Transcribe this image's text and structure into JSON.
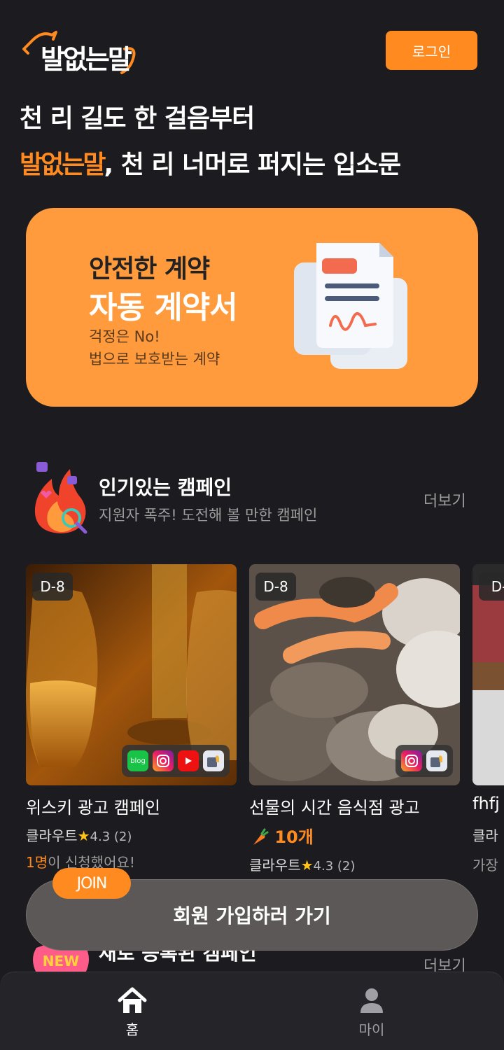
{
  "header": {
    "logo_text": "발없는말",
    "login_label": "로그인"
  },
  "hero": {
    "line1": "천 리 길도 한 걸음부터",
    "line2_brand": "발없는말",
    "line2_rest": ", 천 리 너머로 퍼지는 입소문"
  },
  "banner": {
    "title1": "안전한 계약",
    "title2": "자동 계약서",
    "sub1": "걱정은 No!",
    "sub2": "법으로 보호받는 계약"
  },
  "popular": {
    "title": "인기있는 캠페인",
    "subtitle": "지원자 폭주! 도전해 볼 만한 캠페인",
    "more": "더보기"
  },
  "cards": [
    {
      "dday": "D-8",
      "title": "위스키 광고 캠페인",
      "brand": "클라우트",
      "star": "★",
      "rating": "4.3 (2)",
      "applied_count": "1명",
      "applied_text": "이 신청했어요!",
      "platforms": [
        "blog-icon",
        "instagram-icon",
        "youtube-icon",
        "review-icon"
      ]
    },
    {
      "dday": "D-8",
      "title": "선물의 시간 음식점 광고",
      "reward": "10개",
      "brand": "클라우트",
      "star": "★",
      "rating": "4.3 (2)",
      "platforms": [
        "instagram-icon",
        "review-icon"
      ]
    },
    {
      "dday": "D-",
      "title": "fhfj",
      "brand": "클라",
      "line3": "가장"
    }
  ],
  "new_section": {
    "badge": "NEW",
    "title": "새로 등록된 캠페인",
    "more": "더보기"
  },
  "join": {
    "badge": "JOIN",
    "label": "회원 가입하러 가기"
  },
  "nav": {
    "home": "홈",
    "my": "마이"
  },
  "colors": {
    "accent": "#ff8a1f",
    "background": "#1c1b1f",
    "banner": "#ff9b3d"
  }
}
